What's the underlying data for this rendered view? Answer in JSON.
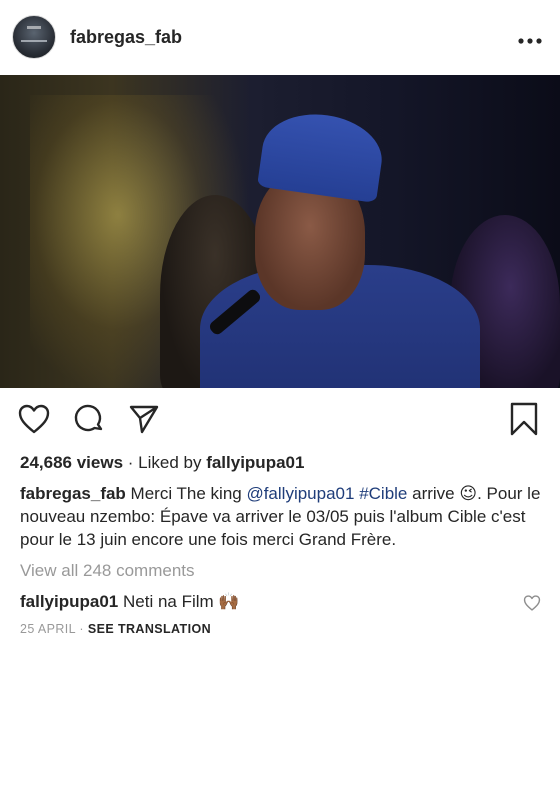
{
  "post": {
    "username": "fabregas_fab",
    "more_icon": "more-horizontal-icon",
    "avatar_label": "profile-avatar"
  },
  "actions": {
    "like_icon": "heart-icon",
    "comment_icon": "comment-icon",
    "share_icon": "send-icon",
    "save_icon": "bookmark-icon"
  },
  "stats": {
    "views": "24,686 views",
    "separator": " · ",
    "liked_by_prefix": "Liked by ",
    "liked_by_user": "fallyipupa01"
  },
  "caption": {
    "author": "fabregas_fab",
    "text_1": " Merci The king ",
    "mention": "@fallyipupa01",
    "text_2": " ",
    "hashtag": "#Cible",
    "text_3": " arrive ",
    "emoji_1": "😉",
    "text_4": ". Pour le nouveau nzembo: Épave va arriver le 03/05 puis l'album Cible c'est pour le 13 juin encore une fois merci Grand Frère."
  },
  "comments": {
    "view_all": "View all 248 comments",
    "items": [
      {
        "author": "fallyipupa01",
        "text": " Neti na Film ",
        "emoji": "🙌🏾",
        "like_icon": "heart-icon"
      }
    ]
  },
  "footer": {
    "date": "25 APRIL",
    "separator": " · ",
    "see_translation": "SEE TRANSLATION"
  }
}
